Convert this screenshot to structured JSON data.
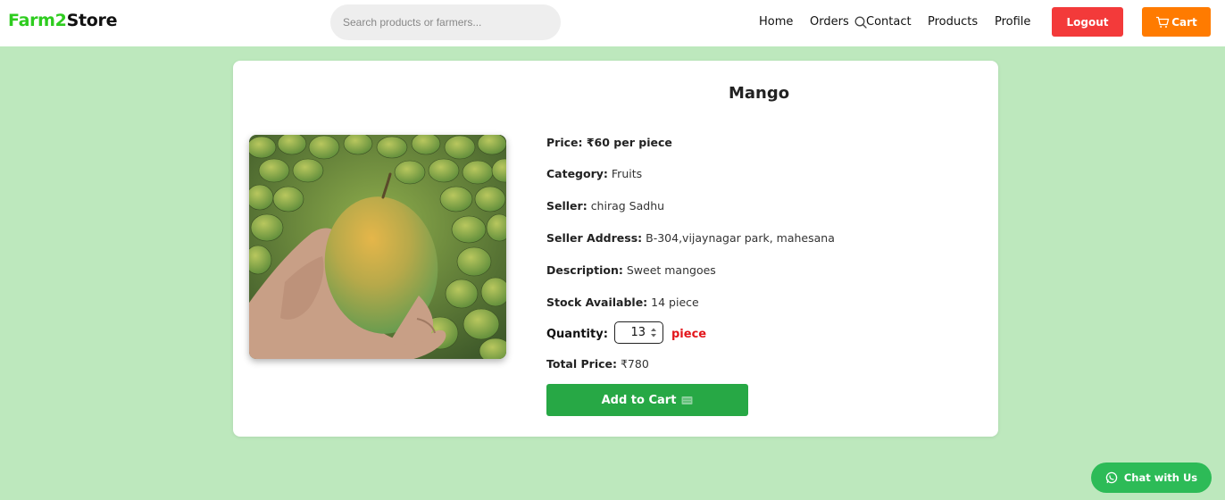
{
  "header": {
    "logo_part1": "Farm2",
    "logo_part2": "Store",
    "search_placeholder": "Search products or farmers...",
    "nav": [
      "Home",
      "Orders",
      "Contact",
      "Products",
      "Profile"
    ],
    "logout_label": "Logout",
    "cart_label": "Cart"
  },
  "product": {
    "name": "Mango",
    "price_label": "Price:",
    "price_value": "₹60 per piece",
    "category_label": "Category:",
    "category_value": "Fruits",
    "seller_label": "Seller:",
    "seller_value": "chirag Sadhu",
    "address_label": "Seller Address:",
    "address_value": "B-304,vijaynagar park, mahesana",
    "description_label": "Description:",
    "description_value": "Sweet mangoes",
    "stock_label": "Stock Available:",
    "stock_value": "14 piece",
    "quantity_label": "Quantity:",
    "quantity_value": "13",
    "quantity_unit": "piece",
    "total_label": "Total Price:",
    "total_value": "₹780",
    "add_to_cart_label": "Add to Cart"
  },
  "chat": {
    "label": "Chat with Us"
  },
  "colors": {
    "background": "#bde8bd",
    "logo_green": "#2ecc1f",
    "logout": "#f33a3a",
    "cart": "#ff7b00",
    "add_to_cart": "#27a845",
    "chat": "#2dbb57",
    "unit_red": "#e3161b"
  },
  "icons": {
    "search": "search-icon",
    "cart": "cart-icon",
    "add_to_cart": "cart-box-icon",
    "chat": "whatsapp-icon"
  }
}
